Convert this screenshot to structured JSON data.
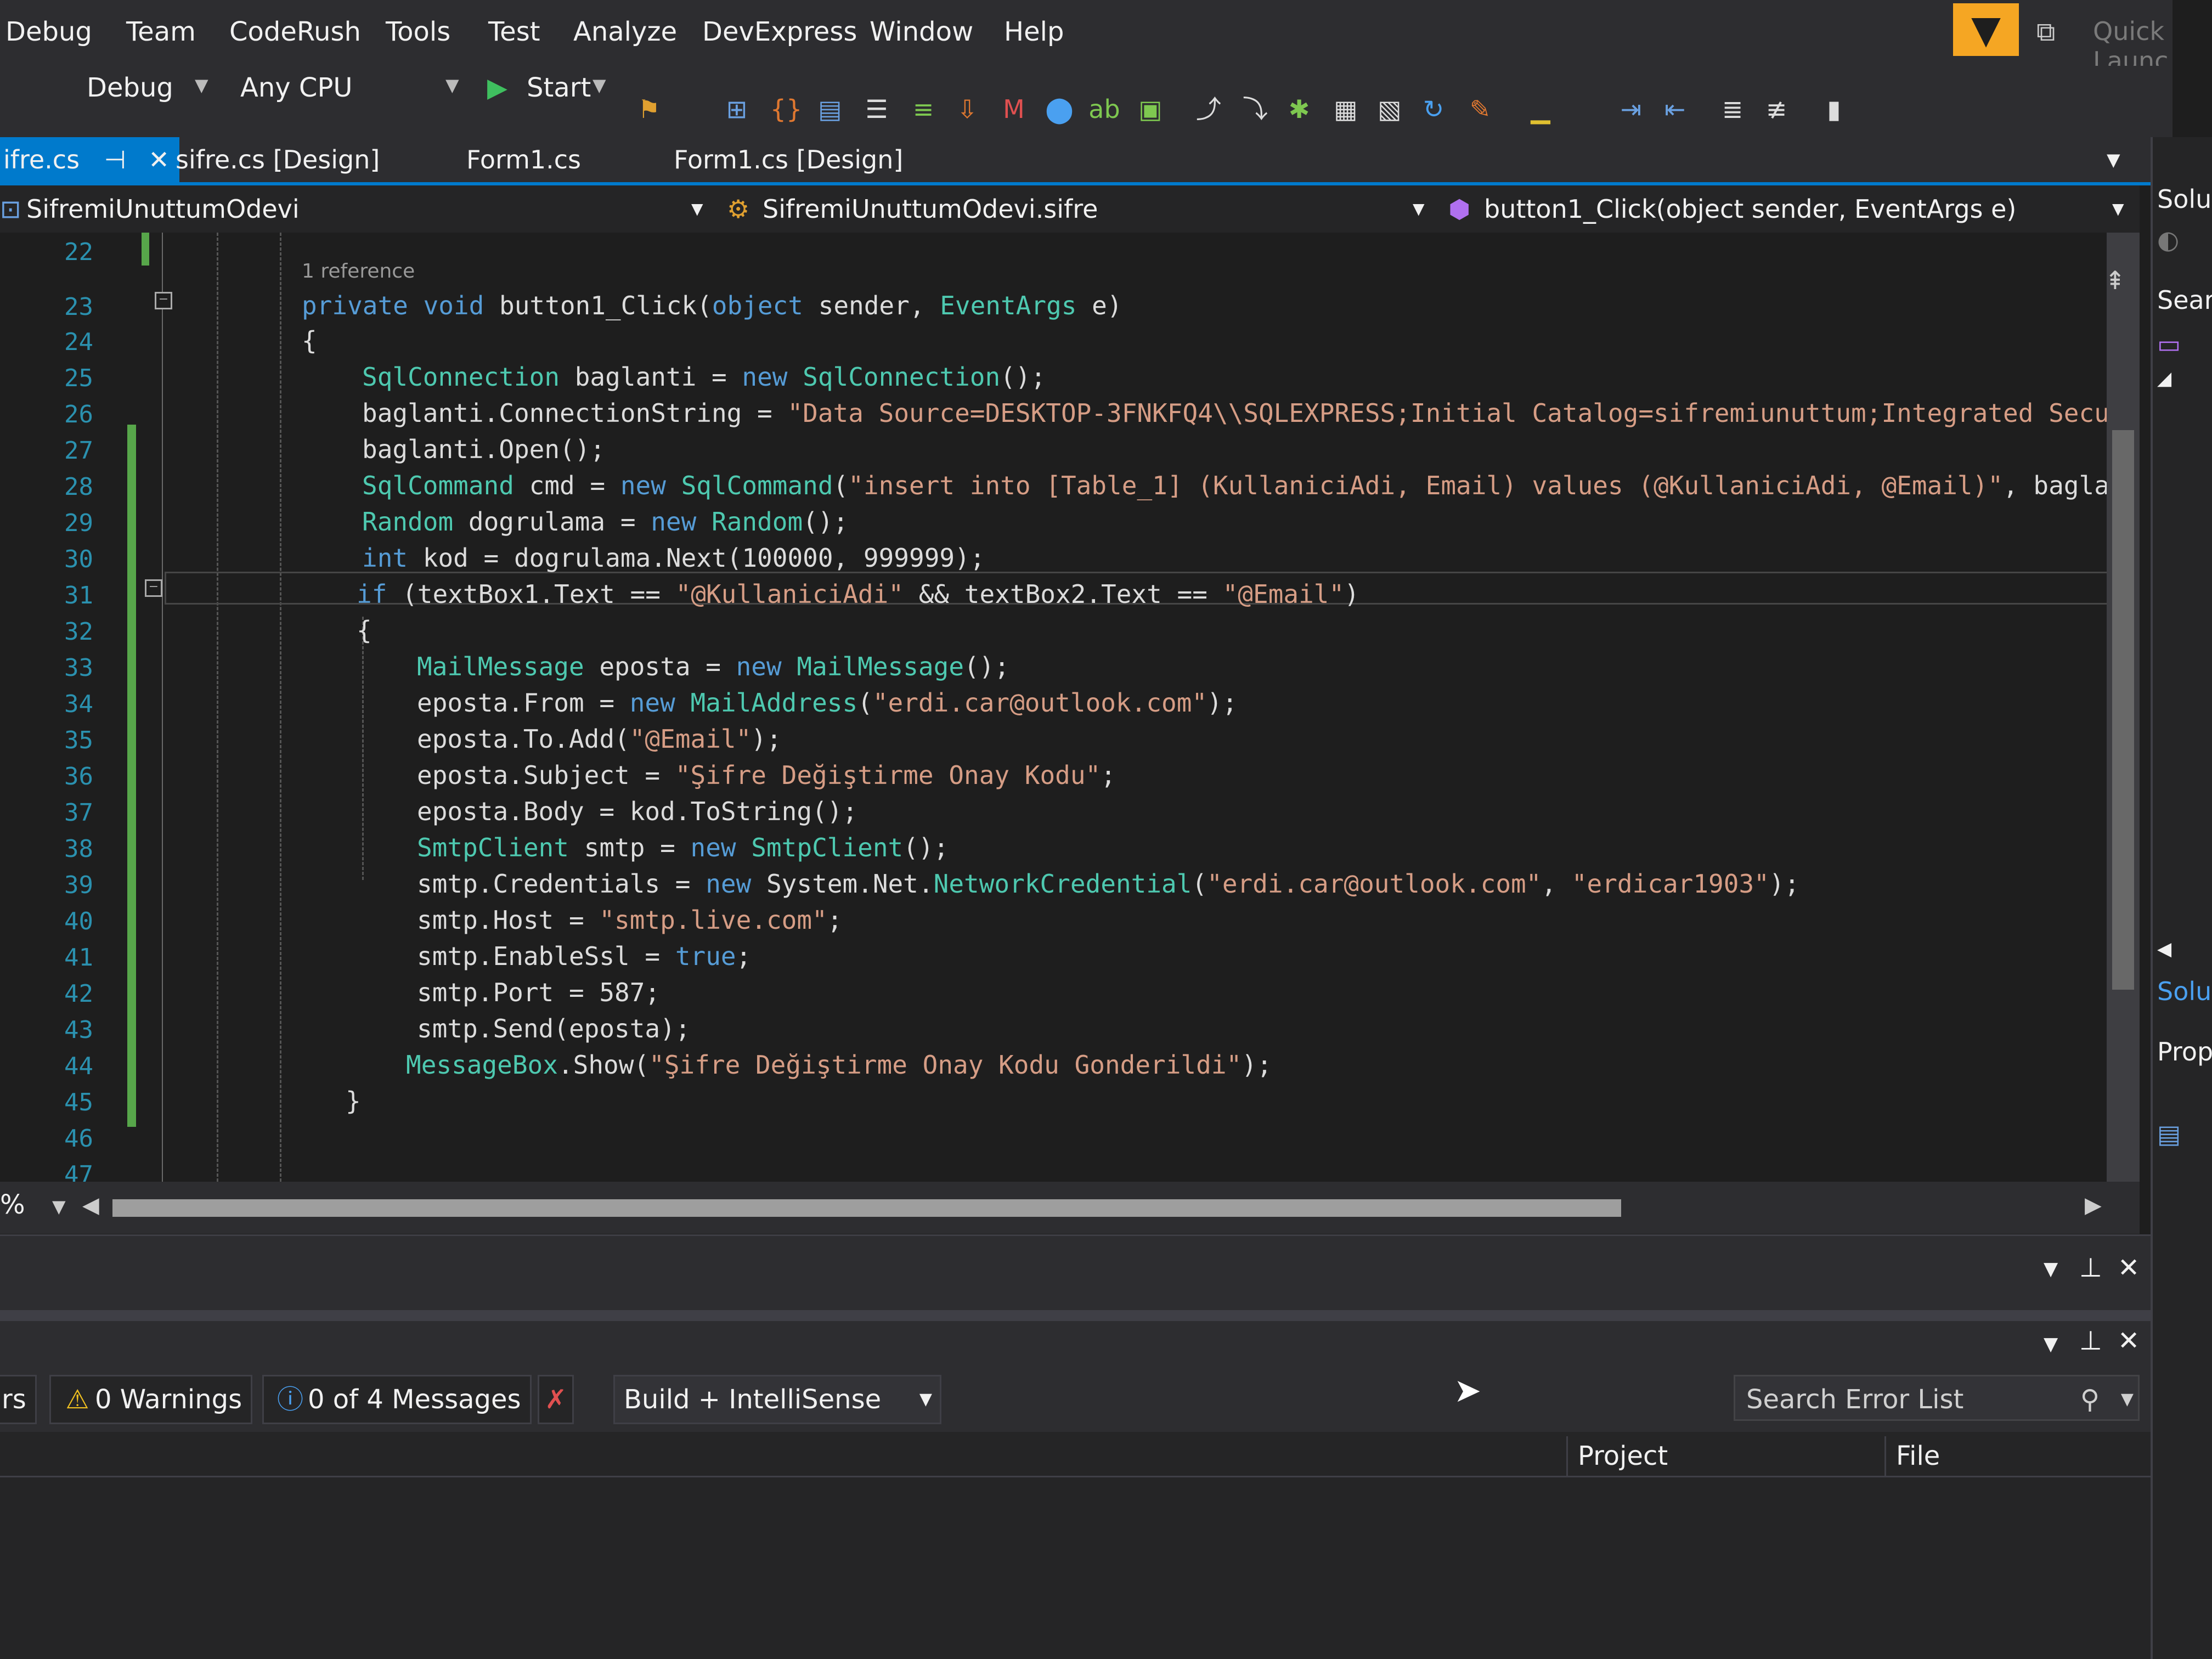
{
  "menu": {
    "items": [
      "Debug",
      "Team",
      "CodeRush",
      "Tools",
      "Test",
      "Analyze",
      "DevExpress",
      "Window",
      "Help"
    ],
    "quick_launch": "Quick Launc"
  },
  "toolbar": {
    "config": "Debug",
    "platform": "Any CPU",
    "start_label": "Start"
  },
  "tabs": [
    {
      "label": "ifre.cs",
      "active": true
    },
    {
      "label": "sifre.cs [Design]",
      "active": false
    },
    {
      "label": "Form1.cs",
      "active": false
    },
    {
      "label": "Form1.cs [Design]",
      "active": false
    }
  ],
  "navbar": {
    "project": "SifremiUnuttumOdevi",
    "class": "SifremiUnuttumOdevi.sifre",
    "member": "button1_Click(object sender, EventArgs e)"
  },
  "editor": {
    "line_numbers": [
      "22",
      "23",
      "24",
      "25",
      "26",
      "27",
      "28",
      "29",
      "30",
      "31",
      "32",
      "33",
      "34",
      "35",
      "36",
      "37",
      "38",
      "39",
      "40",
      "41",
      "42",
      "43",
      "44",
      "45",
      "46",
      "47"
    ],
    "codelens": "1 reference",
    "lines": [
      [
        {
          "t": "private ",
          "k": "kw"
        },
        {
          "t": "void ",
          "k": "kw"
        },
        {
          "t": "button1_Click(",
          "k": ""
        },
        {
          "t": "object ",
          "k": "kw"
        },
        {
          "t": "sender, ",
          "k": ""
        },
        {
          "t": "EventArgs ",
          "k": "ty"
        },
        {
          "t": "e)",
          "k": ""
        }
      ],
      [
        {
          "t": "{",
          "k": ""
        }
      ],
      [
        {
          "t": "SqlConnection ",
          "k": "ty"
        },
        {
          "t": "baglanti = ",
          "k": ""
        },
        {
          "t": "new ",
          "k": "kw"
        },
        {
          "t": "SqlConnection",
          "k": "ty"
        },
        {
          "t": "();",
          "k": ""
        }
      ],
      [
        {
          "t": "baglanti.ConnectionString = ",
          "k": ""
        },
        {
          "t": "\"Data Source=DESKTOP-3FNKFQ4\\\\SQLEXPRESS;Initial Catalog=sifremiunuttum;Integrated Secu",
          "k": "st"
        }
      ],
      [
        {
          "t": "baglanti.Open();",
          "k": ""
        }
      ],
      [
        {
          "t": "SqlCommand ",
          "k": "ty"
        },
        {
          "t": "cmd = ",
          "k": ""
        },
        {
          "t": "new ",
          "k": "kw"
        },
        {
          "t": "SqlCommand",
          "k": "ty"
        },
        {
          "t": "(",
          "k": ""
        },
        {
          "t": "\"insert into [Table_1] (KullaniciAdi, Email) values (@KullaniciAdi, @Email)\"",
          "k": "st"
        },
        {
          "t": ", bagla",
          "k": ""
        }
      ],
      [
        {
          "t": "Random ",
          "k": "ty"
        },
        {
          "t": "dogrulama = ",
          "k": ""
        },
        {
          "t": "new ",
          "k": "kw"
        },
        {
          "t": "Random",
          "k": "ty"
        },
        {
          "t": "();",
          "k": ""
        }
      ],
      [
        {
          "t": "int ",
          "k": "kw"
        },
        {
          "t": "kod = dogrulama.Next(100000, 999999);",
          "k": ""
        }
      ],
      [
        {
          "t": "if ",
          "k": "kw"
        },
        {
          "t": "(textBox1.Text == ",
          "k": ""
        },
        {
          "t": "\"@KullaniciAdi\"",
          "k": "st"
        },
        {
          "t": " && textBox2.Text == ",
          "k": ""
        },
        {
          "t": "\"@Email\"",
          "k": "st"
        },
        {
          "t": ")",
          "k": ""
        }
      ],
      [
        {
          "t": "{",
          "k": ""
        }
      ],
      [
        {
          "t": "MailMessage ",
          "k": "ty"
        },
        {
          "t": "eposta = ",
          "k": ""
        },
        {
          "t": "new ",
          "k": "kw"
        },
        {
          "t": "MailMessage",
          "k": "ty"
        },
        {
          "t": "();",
          "k": ""
        }
      ],
      [
        {
          "t": "eposta.From = ",
          "k": ""
        },
        {
          "t": "new ",
          "k": "kw"
        },
        {
          "t": "MailAddress",
          "k": "ty"
        },
        {
          "t": "(",
          "k": ""
        },
        {
          "t": "\"erdi.car@outlook.com\"",
          "k": "st"
        },
        {
          "t": ");",
          "k": ""
        }
      ],
      [
        {
          "t": "eposta.To.Add(",
          "k": ""
        },
        {
          "t": "\"@Email\"",
          "k": "st"
        },
        {
          "t": ");",
          "k": ""
        }
      ],
      [
        {
          "t": "eposta.Subject = ",
          "k": ""
        },
        {
          "t": "\"Şifre Değiştirme Onay Kodu\"",
          "k": "st"
        },
        {
          "t": ";",
          "k": ""
        }
      ],
      [
        {
          "t": "eposta.Body = kod.ToString();",
          "k": ""
        }
      ],
      [
        {
          "t": "SmtpClient ",
          "k": "ty"
        },
        {
          "t": "smtp = ",
          "k": ""
        },
        {
          "t": "new ",
          "k": "kw"
        },
        {
          "t": "SmtpClient",
          "k": "ty"
        },
        {
          "t": "();",
          "k": ""
        }
      ],
      [
        {
          "t": "smtp.Credentials = ",
          "k": ""
        },
        {
          "t": "new ",
          "k": "kw"
        },
        {
          "t": "System.Net.",
          "k": ""
        },
        {
          "t": "NetworkCredential",
          "k": "ty"
        },
        {
          "t": "(",
          "k": ""
        },
        {
          "t": "\"erdi.car@outlook.com\"",
          "k": "st"
        },
        {
          "t": ", ",
          "k": ""
        },
        {
          "t": "\"erdicar1903\"",
          "k": "st"
        },
        {
          "t": ");",
          "k": ""
        }
      ],
      [
        {
          "t": "smtp.Host = ",
          "k": ""
        },
        {
          "t": "\"smtp.live.com\"",
          "k": "st"
        },
        {
          "t": ";",
          "k": ""
        }
      ],
      [
        {
          "t": "smtp.EnableSsl = ",
          "k": ""
        },
        {
          "t": "true",
          "k": "kw"
        },
        {
          "t": ";",
          "k": ""
        }
      ],
      [
        {
          "t": "smtp.Port = 587;",
          "k": ""
        }
      ],
      [
        {
          "t": "smtp.Send(eposta);",
          "k": ""
        }
      ],
      [
        {
          "t": "MessageBox",
          "k": "ty"
        },
        {
          "t": ".Show(",
          "k": ""
        },
        {
          "t": "\"Şifre Değiştirme Onay Kodu Gonderildi\"",
          "k": "st"
        },
        {
          "t": ");",
          "k": ""
        }
      ],
      [
        {
          "t": "}",
          "k": ""
        }
      ]
    ],
    "zoom": "%"
  },
  "error_list": {
    "errors_label": "rs",
    "warnings_label": "0 Warnings",
    "messages_label": "0 of 4 Messages",
    "scope": "Build + IntelliSense",
    "search_placeholder": "Search Error List",
    "columns": [
      "Project",
      "File"
    ]
  },
  "right_panel": {
    "solution_label": "Soluti",
    "search_label": "Searc",
    "solution_tab": "Solu",
    "properties_tab": "Prop"
  },
  "colors": {
    "accent": "#007acc",
    "keyword": "#569cd6",
    "type": "#4ec9b0",
    "string": "#d69d85",
    "line_number": "#2b91af",
    "filter": "#f5a623"
  }
}
